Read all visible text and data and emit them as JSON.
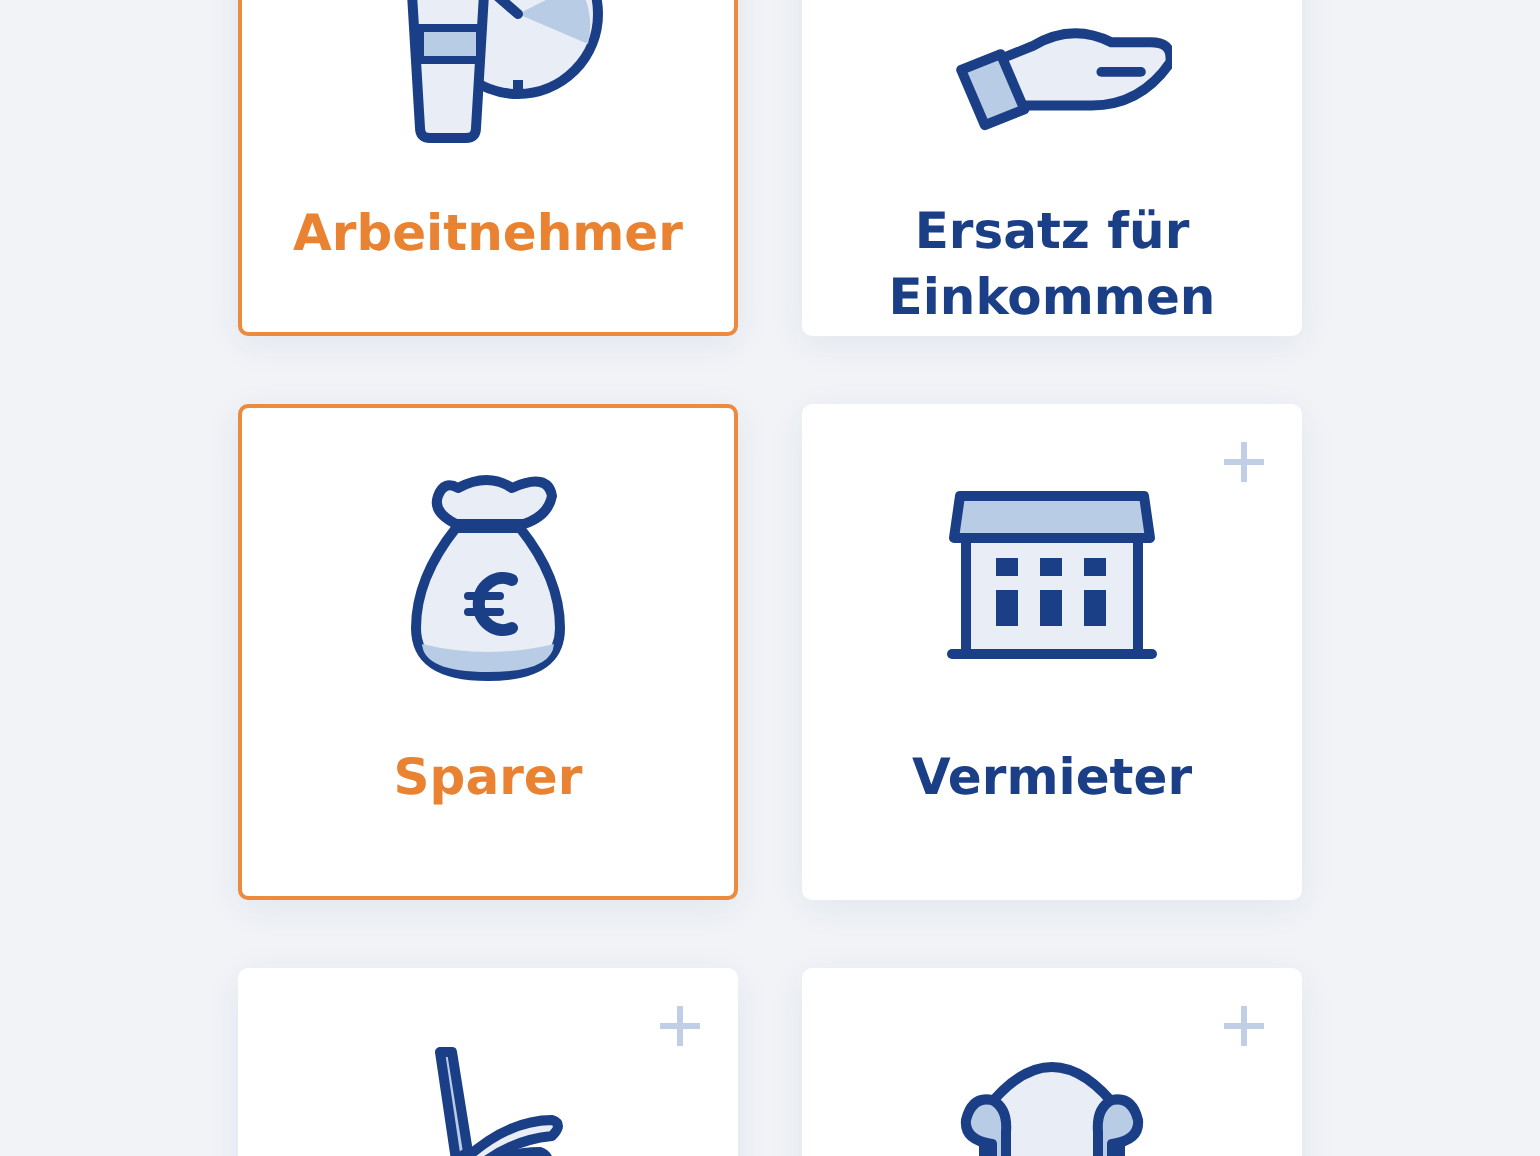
{
  "cards": [
    {
      "kind": "cup-clock",
      "label": "Arbeitnehmer",
      "selected": true
    },
    {
      "kind": "hand",
      "label": "Ersatz für Einkommen",
      "selected": false
    },
    {
      "kind": "money-bag",
      "label": "Sparer",
      "selected": true
    },
    {
      "kind": "building",
      "label": "Vermieter",
      "selected": false
    },
    {
      "kind": "recliner",
      "selected": false
    },
    {
      "kind": "armchair",
      "selected": false
    }
  ]
}
